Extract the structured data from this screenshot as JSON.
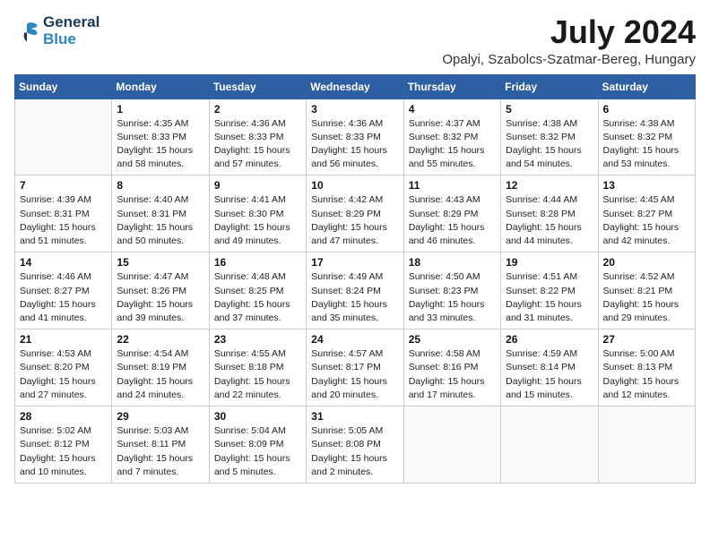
{
  "logo": {
    "line1": "General",
    "line2": "Blue"
  },
  "title": "July 2024",
  "location": "Opalyi, Szabolcs-Szatmar-Bereg, Hungary",
  "days_of_week": [
    "Sunday",
    "Monday",
    "Tuesday",
    "Wednesday",
    "Thursday",
    "Friday",
    "Saturday"
  ],
  "weeks": [
    [
      {
        "day": "",
        "info": ""
      },
      {
        "day": "1",
        "info": "Sunrise: 4:35 AM\nSunset: 8:33 PM\nDaylight: 15 hours\nand 58 minutes."
      },
      {
        "day": "2",
        "info": "Sunrise: 4:36 AM\nSunset: 8:33 PM\nDaylight: 15 hours\nand 57 minutes."
      },
      {
        "day": "3",
        "info": "Sunrise: 4:36 AM\nSunset: 8:33 PM\nDaylight: 15 hours\nand 56 minutes."
      },
      {
        "day": "4",
        "info": "Sunrise: 4:37 AM\nSunset: 8:32 PM\nDaylight: 15 hours\nand 55 minutes."
      },
      {
        "day": "5",
        "info": "Sunrise: 4:38 AM\nSunset: 8:32 PM\nDaylight: 15 hours\nand 54 minutes."
      },
      {
        "day": "6",
        "info": "Sunrise: 4:38 AM\nSunset: 8:32 PM\nDaylight: 15 hours\nand 53 minutes."
      }
    ],
    [
      {
        "day": "7",
        "info": "Sunrise: 4:39 AM\nSunset: 8:31 PM\nDaylight: 15 hours\nand 51 minutes."
      },
      {
        "day": "8",
        "info": "Sunrise: 4:40 AM\nSunset: 8:31 PM\nDaylight: 15 hours\nand 50 minutes."
      },
      {
        "day": "9",
        "info": "Sunrise: 4:41 AM\nSunset: 8:30 PM\nDaylight: 15 hours\nand 49 minutes."
      },
      {
        "day": "10",
        "info": "Sunrise: 4:42 AM\nSunset: 8:29 PM\nDaylight: 15 hours\nand 47 minutes."
      },
      {
        "day": "11",
        "info": "Sunrise: 4:43 AM\nSunset: 8:29 PM\nDaylight: 15 hours\nand 46 minutes."
      },
      {
        "day": "12",
        "info": "Sunrise: 4:44 AM\nSunset: 8:28 PM\nDaylight: 15 hours\nand 44 minutes."
      },
      {
        "day": "13",
        "info": "Sunrise: 4:45 AM\nSunset: 8:27 PM\nDaylight: 15 hours\nand 42 minutes."
      }
    ],
    [
      {
        "day": "14",
        "info": "Sunrise: 4:46 AM\nSunset: 8:27 PM\nDaylight: 15 hours\nand 41 minutes."
      },
      {
        "day": "15",
        "info": "Sunrise: 4:47 AM\nSunset: 8:26 PM\nDaylight: 15 hours\nand 39 minutes."
      },
      {
        "day": "16",
        "info": "Sunrise: 4:48 AM\nSunset: 8:25 PM\nDaylight: 15 hours\nand 37 minutes."
      },
      {
        "day": "17",
        "info": "Sunrise: 4:49 AM\nSunset: 8:24 PM\nDaylight: 15 hours\nand 35 minutes."
      },
      {
        "day": "18",
        "info": "Sunrise: 4:50 AM\nSunset: 8:23 PM\nDaylight: 15 hours\nand 33 minutes."
      },
      {
        "day": "19",
        "info": "Sunrise: 4:51 AM\nSunset: 8:22 PM\nDaylight: 15 hours\nand 31 minutes."
      },
      {
        "day": "20",
        "info": "Sunrise: 4:52 AM\nSunset: 8:21 PM\nDaylight: 15 hours\nand 29 minutes."
      }
    ],
    [
      {
        "day": "21",
        "info": "Sunrise: 4:53 AM\nSunset: 8:20 PM\nDaylight: 15 hours\nand 27 minutes."
      },
      {
        "day": "22",
        "info": "Sunrise: 4:54 AM\nSunset: 8:19 PM\nDaylight: 15 hours\nand 24 minutes."
      },
      {
        "day": "23",
        "info": "Sunrise: 4:55 AM\nSunset: 8:18 PM\nDaylight: 15 hours\nand 22 minutes."
      },
      {
        "day": "24",
        "info": "Sunrise: 4:57 AM\nSunset: 8:17 PM\nDaylight: 15 hours\nand 20 minutes."
      },
      {
        "day": "25",
        "info": "Sunrise: 4:58 AM\nSunset: 8:16 PM\nDaylight: 15 hours\nand 17 minutes."
      },
      {
        "day": "26",
        "info": "Sunrise: 4:59 AM\nSunset: 8:14 PM\nDaylight: 15 hours\nand 15 minutes."
      },
      {
        "day": "27",
        "info": "Sunrise: 5:00 AM\nSunset: 8:13 PM\nDaylight: 15 hours\nand 12 minutes."
      }
    ],
    [
      {
        "day": "28",
        "info": "Sunrise: 5:02 AM\nSunset: 8:12 PM\nDaylight: 15 hours\nand 10 minutes."
      },
      {
        "day": "29",
        "info": "Sunrise: 5:03 AM\nSunset: 8:11 PM\nDaylight: 15 hours\nand 7 minutes."
      },
      {
        "day": "30",
        "info": "Sunrise: 5:04 AM\nSunset: 8:09 PM\nDaylight: 15 hours\nand 5 minutes."
      },
      {
        "day": "31",
        "info": "Sunrise: 5:05 AM\nSunset: 8:08 PM\nDaylight: 15 hours\nand 2 minutes."
      },
      {
        "day": "",
        "info": ""
      },
      {
        "day": "",
        "info": ""
      },
      {
        "day": "",
        "info": ""
      }
    ]
  ]
}
